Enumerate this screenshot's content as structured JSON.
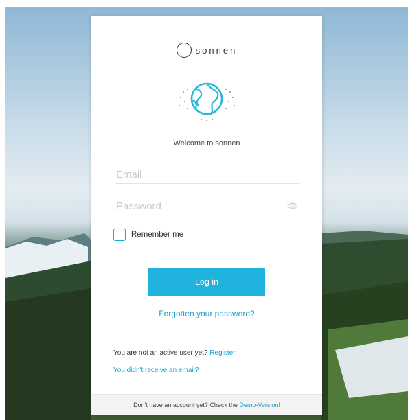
{
  "brand": {
    "name": "sonnen"
  },
  "welcome_text": "Welcome to sonnen",
  "email": {
    "placeholder": "Email",
    "value": ""
  },
  "password": {
    "placeholder": "Password",
    "value": ""
  },
  "remember": {
    "label": "Remember me",
    "checked": false
  },
  "login": {
    "label": "Log in"
  },
  "forgot_link": "Forgotten your password?",
  "register": {
    "prompt": "You are not an active user yet?",
    "link": "Register"
  },
  "no_email_link": "You didn't receive an email?",
  "footer": {
    "prompt": "Don't have an account yet? Check the",
    "link": "Demo-Version!"
  },
  "icons": {
    "logo": "circle-logo-icon",
    "illustration": "globe-icon",
    "password_toggle": "eye-icon"
  },
  "colors": {
    "accent": "#1fb2dc",
    "link": "#1a9fc9",
    "checkbox_border": "#1aa6cc"
  }
}
